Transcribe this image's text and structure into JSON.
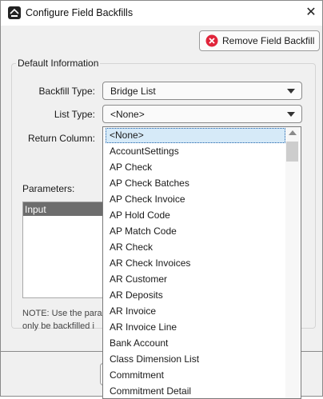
{
  "window": {
    "title": "Configure Field Backfills"
  },
  "toolbar": {
    "remove_label": "Remove Field Backfill"
  },
  "default_info": {
    "legend": "Default Information",
    "backfill_type_label": "Backfill Type:",
    "backfill_type_value": "Bridge List",
    "list_type_label": "List Type:",
    "list_type_value": "<None>",
    "return_column_label": "Return Column:"
  },
  "parameters": {
    "label": "Parameters:",
    "header": "Input"
  },
  "note": {
    "line1": "NOTE: Use the para",
    "line2": "only be backfilled i"
  },
  "dropdown": {
    "items": [
      "<None>",
      "AccountSettings",
      "AP Check",
      "AP Check Batches",
      "AP Check Invoice",
      "AP Hold Code",
      "AP Match Code",
      "AR Check",
      "AR Check Invoices",
      "AR Customer",
      "AR Deposits",
      "AR Invoice",
      "AR Invoice Line",
      "Bank Account",
      "Class Dimension List",
      "Commitment",
      "Commitment Detail"
    ],
    "selected_index": 0
  },
  "icons": {
    "app": "app-logo-icon",
    "close": "close-icon",
    "remove": "remove-circle-x-icon",
    "chevron": "chevron-down-icon"
  },
  "colors": {
    "remove_icon": "#e0243a",
    "header_bg": "#6d6d6d",
    "selection": "#d6eaf8"
  }
}
